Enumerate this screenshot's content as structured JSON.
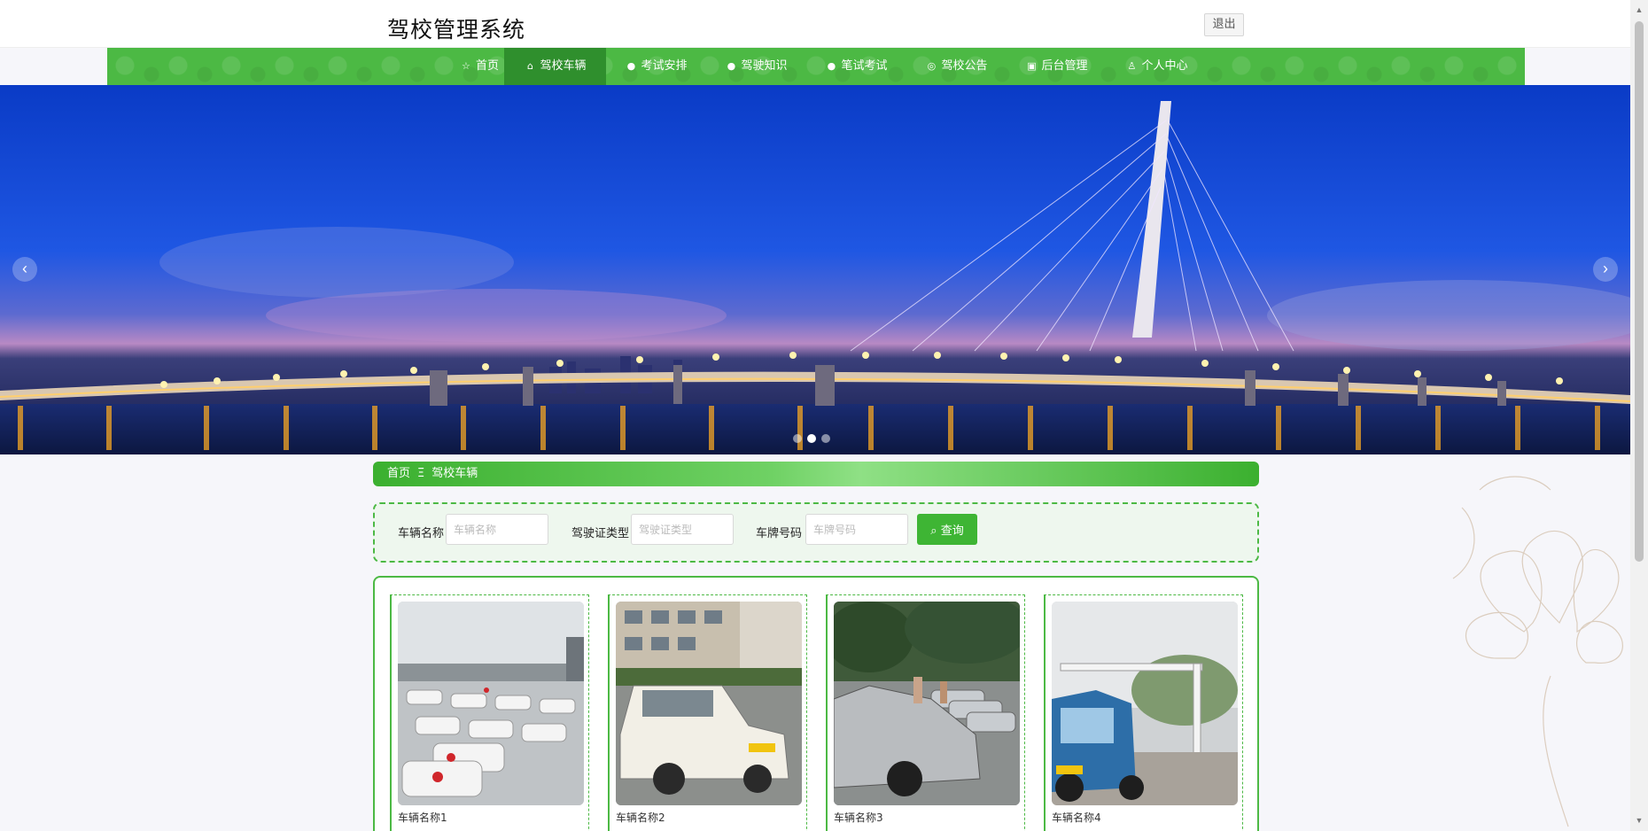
{
  "header": {
    "site_title": "驾校管理系统",
    "logout_label": "退出"
  },
  "nav": {
    "items": [
      {
        "label": "首页",
        "icon": "star-icon",
        "glyph": "☆"
      },
      {
        "label": "驾校车辆",
        "icon": "shopping-bag-icon",
        "glyph": "⌂"
      },
      {
        "label": "考试安排",
        "icon": "info-icon",
        "glyph": "●"
      },
      {
        "label": "驾驶知识",
        "icon": "info-icon",
        "glyph": "●"
      },
      {
        "label": "笔试考试",
        "icon": "info-icon",
        "glyph": "●"
      },
      {
        "label": "驾校公告",
        "icon": "globe-icon",
        "glyph": "◎"
      },
      {
        "label": "后台管理",
        "icon": "briefcase-icon",
        "glyph": "▣"
      },
      {
        "label": "个人中心",
        "icon": "user-icon",
        "glyph": "♙"
      }
    ],
    "active_index": 1
  },
  "banner": {
    "prev_label": "‹",
    "next_label": "›",
    "slide_count": 3,
    "active_slide": 2
  },
  "breadcrumb": {
    "home": "首页",
    "separator": "Ξ",
    "current": "驾校车辆"
  },
  "search": {
    "fields": [
      {
        "label": "车辆名称",
        "placeholder": "车辆名称",
        "value": ""
      },
      {
        "label": "驾驶证类型",
        "placeholder": "驾驶证类型",
        "value": ""
      },
      {
        "label": "车牌号码",
        "placeholder": "车牌号码",
        "value": ""
      }
    ],
    "button_label": "查询",
    "button_icon": "search-icon"
  },
  "vehicles": [
    {
      "name": "车辆名称1"
    },
    {
      "name": "车辆名称2"
    },
    {
      "name": "车辆名称3"
    },
    {
      "name": "车辆名称4"
    }
  ],
  "colors": {
    "accent": "#4cb944",
    "accent_dark": "#2f8f2d",
    "page_bg": "#f6f6fa"
  }
}
